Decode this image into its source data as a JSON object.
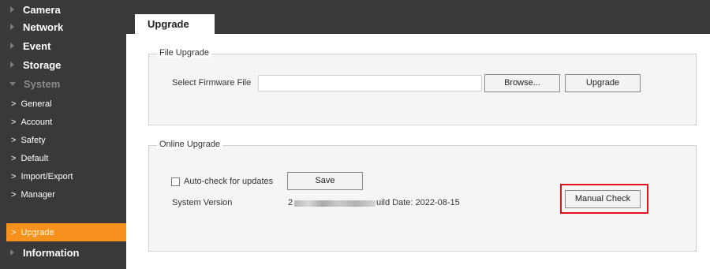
{
  "sidebar": {
    "camera": "Camera",
    "network": "Network",
    "event": "Event",
    "storage": "Storage",
    "system": "System",
    "system_items": {
      "general": "General",
      "account": "Account",
      "safety": "Safety",
      "default": "Default",
      "import_export": "Import/Export",
      "manager": "Manager",
      "upgrade": "Upgrade"
    },
    "information": "Information"
  },
  "tab": {
    "label": "Upgrade"
  },
  "file_upgrade": {
    "legend": "File Upgrade",
    "select_label": "Select Firmware File",
    "file_value": "",
    "browse_label": "Browse...",
    "upgrade_label": "Upgrade"
  },
  "online_upgrade": {
    "legend": "Online Upgrade",
    "auto_check_label": "Auto-check for updates",
    "auto_check_checked": false,
    "save_label": "Save",
    "system_version_label": "System Version",
    "version_prefix": "2",
    "build_date_text": "uild Date: 2022-08-15",
    "manual_check_label": "Manual Check"
  },
  "colors": {
    "sidebar_bg": "#393939",
    "active_item": "#f7921e",
    "highlight_box": "#e2111c"
  }
}
